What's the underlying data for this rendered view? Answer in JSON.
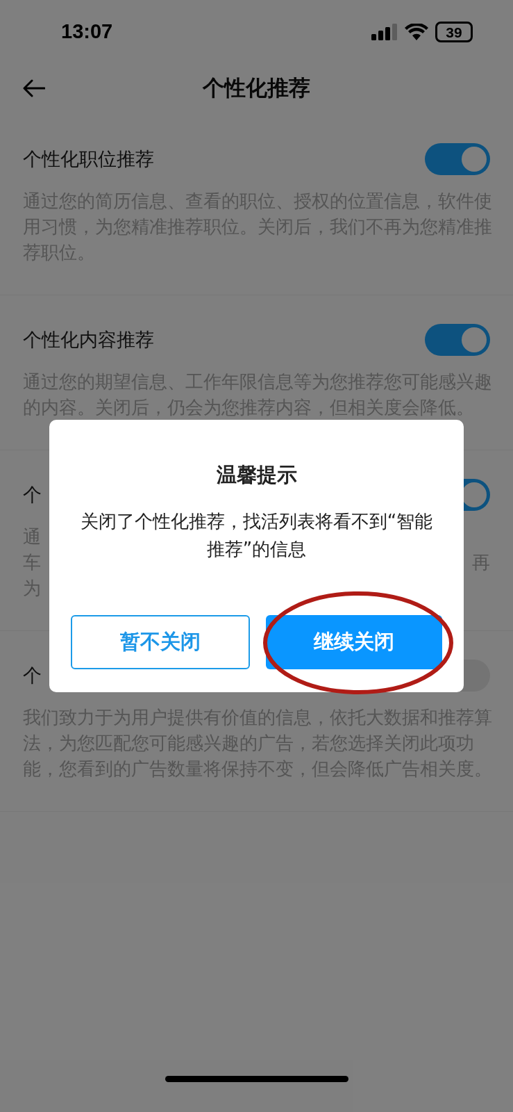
{
  "status_bar": {
    "time": "13:07",
    "battery": "39"
  },
  "header": {
    "title": "个性化推荐"
  },
  "settings": [
    {
      "kind": "full",
      "title": "个性化职位推荐",
      "on": true,
      "description": "通过您的简历信息、查看的职位、授权的位置信息，软件使用习惯，为您精准推荐职位。关闭后，我们不再为您精准推荐职位。"
    },
    {
      "kind": "full",
      "title": "个性化内容推荐",
      "on": true,
      "description": "通过您的期望信息、工作年限信息等为您推荐您可能感兴趣的内容。关闭后，仍会为您推荐内容，但相关度会降低。"
    },
    {
      "kind": "covered",
      "title": "个",
      "on": true,
      "description_lines": [
        [
          "通"
        ],
        [
          "车",
          "再"
        ],
        [
          "为"
        ]
      ]
    },
    {
      "kind": "full",
      "title": "个",
      "on": false,
      "description": "我们致力于为用户提供有价值的信息，依托大数据和推荐算法，为您匹配您可能感兴趣的广告，若您选择关闭此项功能，您看到的广告数量将保持不变，但会降低广告相关度。"
    }
  ],
  "dialog": {
    "title": "温馨提示",
    "message": "关闭了个性化推荐，找活列表将看不到“智能推荐”的信息",
    "buttons": [
      {
        "kind": "secondary",
        "label": "暂不关闭"
      },
      {
        "kind": "primary",
        "label": "继续关闭",
        "highlighted": true
      }
    ]
  }
}
